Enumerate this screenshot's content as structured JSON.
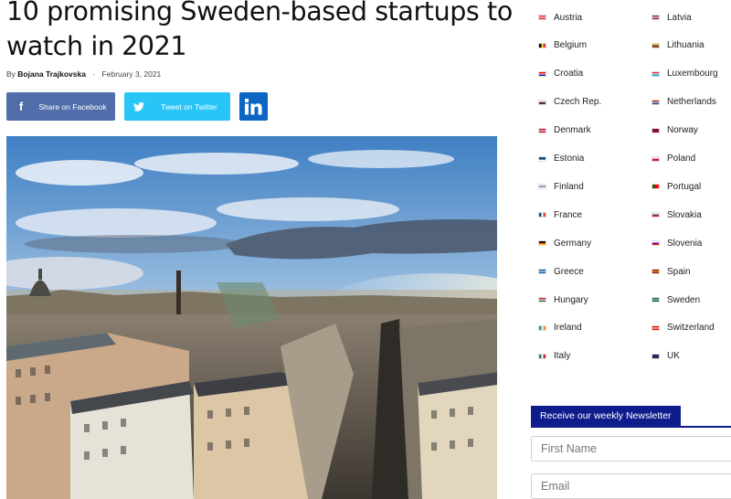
{
  "article": {
    "title": "10 promising Sweden-based startups to watch in 2021",
    "by_label": "By",
    "author": "Bojana Trajkovska",
    "separator": "-",
    "date": "February 3, 2021"
  },
  "share": {
    "facebook_label": "Share on Facebook",
    "twitter_label": "Tweet on Twitter",
    "linkedin_label": "in"
  },
  "countries": [
    {
      "name": "Austria",
      "flag": [
        "#ed2939",
        "#ffffff",
        "#ed2939"
      ]
    },
    {
      "name": "Latvia",
      "flag": [
        "#9e3039",
        "#ffffff",
        "#9e3039"
      ]
    },
    {
      "name": "Belgium",
      "flag": [
        "#000000",
        "#fdda24",
        "#ef3340"
      ],
      "vertical": true
    },
    {
      "name": "Lithuania",
      "flag": [
        "#fdb913",
        "#006a44",
        "#c1272d"
      ]
    },
    {
      "name": "Croatia",
      "flag": [
        "#ff0000",
        "#ffffff",
        "#171796"
      ]
    },
    {
      "name": "Luxembourg",
      "flag": [
        "#ed2939",
        "#ffffff",
        "#00a1de"
      ]
    },
    {
      "name": "Czech Rep.",
      "flag": [
        "#ffffff",
        "#d7141a",
        "#11457e"
      ]
    },
    {
      "name": "Netherlands",
      "flag": [
        "#ae1c28",
        "#ffffff",
        "#21468b"
      ]
    },
    {
      "name": "Denmark",
      "flag": [
        "#c8102e",
        "#ffffff",
        "#c8102e"
      ]
    },
    {
      "name": "Norway",
      "flag": [
        "#ba0c2f",
        "#00205b",
        "#ba0c2f"
      ]
    },
    {
      "name": "Estonia",
      "flag": [
        "#0072ce",
        "#000000",
        "#ffffff"
      ]
    },
    {
      "name": "Poland",
      "flag": [
        "#ffffff",
        "#dc143c",
        "#dc143c"
      ]
    },
    {
      "name": "Finland",
      "flag": [
        "#ffffff",
        "#003580",
        "#ffffff"
      ]
    },
    {
      "name": "Portugal",
      "flag": [
        "#006600",
        "#ff0000",
        "#ff0000"
      ],
      "vertical": true
    },
    {
      "name": "France",
      "flag": [
        "#0055a4",
        "#ffffff",
        "#ef4135"
      ],
      "vertical": true
    },
    {
      "name": "Slovakia",
      "flag": [
        "#ffffff",
        "#0b4ea2",
        "#ee1c25"
      ]
    },
    {
      "name": "Germany",
      "flag": [
        "#000000",
        "#dd0000",
        "#ffce00"
      ]
    },
    {
      "name": "Slovenia",
      "flag": [
        "#ffffff",
        "#0000ff",
        "#ff0000"
      ]
    },
    {
      "name": "Greece",
      "flag": [
        "#0d5eaf",
        "#ffffff",
        "#0d5eaf"
      ]
    },
    {
      "name": "Spain",
      "flag": [
        "#aa151b",
        "#f1bf00",
        "#aa151b"
      ]
    },
    {
      "name": "Hungary",
      "flag": [
        "#ce2939",
        "#ffffff",
        "#477050"
      ]
    },
    {
      "name": "Sweden",
      "flag": [
        "#006aa7",
        "#fecc00",
        "#006aa7"
      ]
    },
    {
      "name": "Ireland",
      "flag": [
        "#169b62",
        "#ffffff",
        "#ff883e"
      ],
      "vertical": true
    },
    {
      "name": "Switzerland",
      "flag": [
        "#ff0000",
        "#ffffff",
        "#ff0000"
      ]
    },
    {
      "name": "Italy",
      "flag": [
        "#009246",
        "#ffffff",
        "#ce2b37"
      ],
      "vertical": true
    },
    {
      "name": "UK",
      "flag": [
        "#012169",
        "#c8102e",
        "#012169"
      ]
    }
  ],
  "newsletter": {
    "title": "Receive our weekly Newsletter",
    "first_name_placeholder": "First Name",
    "email_placeholder": "Email"
  },
  "colors": {
    "facebook": "#516eab",
    "twitter": "#29c5f6",
    "linkedin": "#0a66c2",
    "newsletter": "#0f1d8c"
  }
}
